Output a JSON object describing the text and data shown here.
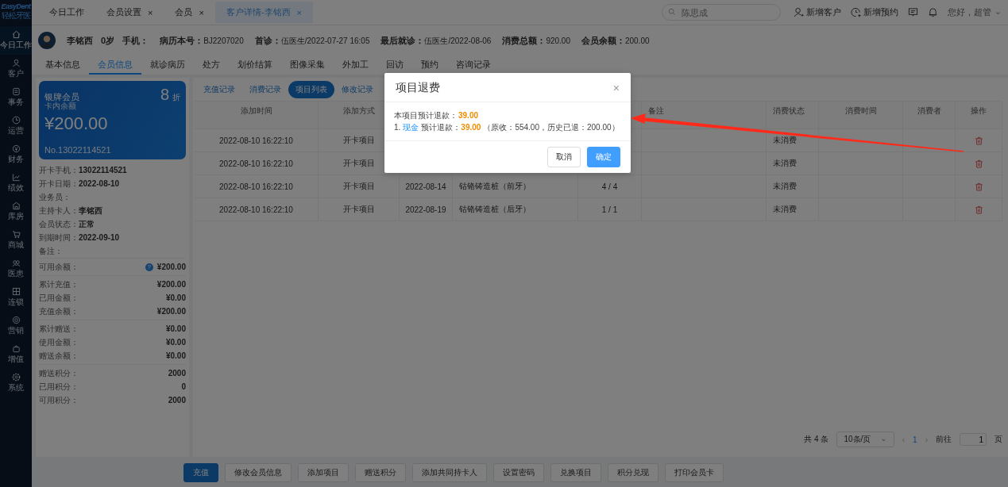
{
  "logo": {
    "brand": "EasyDent",
    "subtitle": "轻松牙医"
  },
  "nav": [
    {
      "label": "今日工作",
      "selected": true
    },
    {
      "label": "客户",
      "selected": false
    },
    {
      "label": "事务",
      "selected": false
    },
    {
      "label": "运营",
      "selected": false
    },
    {
      "label": "财务",
      "selected": false
    },
    {
      "label": "绩效",
      "selected": false
    },
    {
      "label": "库房",
      "selected": false
    },
    {
      "label": "商城",
      "selected": false
    },
    {
      "label": "医患",
      "selected": false
    },
    {
      "label": "连锁",
      "selected": false
    },
    {
      "label": "营销",
      "selected": false
    },
    {
      "label": "增值",
      "selected": false
    },
    {
      "label": "系统",
      "selected": false
    }
  ],
  "tabs": [
    {
      "label": "今日工作",
      "selected": false
    },
    {
      "label": "会员设置",
      "close": "×",
      "selected": false
    },
    {
      "label": "会员",
      "close": "×",
      "selected": false
    },
    {
      "label": "客户详情-李铭西",
      "close": "×",
      "selected": true
    }
  ],
  "search": {
    "placeholder": "陈思成"
  },
  "top_actions": [
    {
      "label": "新增客户"
    },
    {
      "label": "新增预约"
    }
  ],
  "user_menu": {
    "label": "您好，超管",
    "caret": "⌄"
  },
  "patient": {
    "name": "李铭西",
    "age": "0岁",
    "fields": [
      {
        "label": "手机："
      },
      {
        "label": "病历本号：",
        "value": "BJ2207020"
      },
      {
        "label": "首诊：",
        "value": "伍医生/2022-07-27 16:05"
      },
      {
        "label": "最后就诊：",
        "value": "伍医生/2022-08-06"
      },
      {
        "label": "消费总额：",
        "value": "920.00"
      },
      {
        "label": "会员余额：",
        "value": "200.00"
      }
    ]
  },
  "sub_tabs": [
    {
      "label": "基本信息",
      "selected": false
    },
    {
      "label": "会员信息",
      "selected": true
    },
    {
      "label": "就诊病历",
      "selected": false
    },
    {
      "label": "处方",
      "selected": false
    },
    {
      "label": "划价结算",
      "selected": false
    },
    {
      "label": "图像采集",
      "selected": false
    },
    {
      "label": "外加工",
      "selected": false
    },
    {
      "label": "回访",
      "selected": false
    },
    {
      "label": "预约",
      "selected": false
    },
    {
      "label": "咨询记录",
      "selected": false
    }
  ],
  "card": {
    "level": "银牌会员",
    "discount": "8",
    "discount_unit": "折",
    "balance_label": "卡内余额",
    "balance": "¥200.00",
    "number": "No.13022114521"
  },
  "member_info": [
    {
      "label": "开卡手机：",
      "value": "13022114521"
    },
    {
      "label": "开卡日期：",
      "value": "2022-08-10"
    },
    {
      "label": "业务员："
    },
    {
      "label": "主持卡人：",
      "value": "李铭西"
    },
    {
      "label": "会员状态：",
      "value": "正常"
    },
    {
      "label": "到期时间：",
      "value": "2022-09-10"
    },
    {
      "label": "备注："
    }
  ],
  "balance_groups": [
    [
      {
        "label": "可用余额：",
        "value": "¥200.00",
        "help": "?"
      }
    ],
    [
      {
        "label": "累计充值：",
        "value": "¥200.00"
      },
      {
        "label": "已用金额：",
        "value": "¥0.00"
      },
      {
        "label": "充值余额：",
        "value": "¥200.00"
      }
    ],
    [
      {
        "label": "累计赠送：",
        "value": "¥0.00"
      },
      {
        "label": "使用金额：",
        "value": "¥0.00"
      },
      {
        "label": "赠送余额：",
        "value": "¥0.00"
      }
    ],
    [
      {
        "label": "赠送积分：",
        "value": "2000"
      },
      {
        "label": "已用积分：",
        "value": "0"
      },
      {
        "label": "可用积分：",
        "value": "2000"
      }
    ]
  ],
  "record_tabs": [
    {
      "label": "充值记录",
      "selected": false
    },
    {
      "label": "消费记录",
      "selected": false
    },
    {
      "label": "项目列表",
      "selected": true
    },
    {
      "label": "修改记录",
      "selected": false
    }
  ],
  "table": {
    "columns": {
      "added_time": "添加时间",
      "add_method": "添加方式",
      "note": "备注",
      "status": "消费状态",
      "consume_time": "消费时间",
      "consumer": "消费者",
      "action": "操作"
    },
    "rows": [
      {
        "added_time": "2022-08-10 16:22:10",
        "add_method": "开卡项目",
        "status": "未消费"
      },
      {
        "added_time": "2022-08-10 16:22:10",
        "add_method": "开卡项目",
        "status": "未消费"
      },
      {
        "added_time": "2022-08-10 16:22:10",
        "add_method": "开卡项目",
        "column_3": "2022-08-14",
        "column_4": "钴铬铸造桩（前牙）",
        "column_5": "4 / 4",
        "status": "未消费"
      },
      {
        "added_time": "2022-08-10 16:22:10",
        "add_method": "开卡项目",
        "column_3": "2022-08-19",
        "column_4": "钴铬铸造桩（后牙）",
        "column_5": "1 / 1",
        "status": "未消费"
      }
    ]
  },
  "pagination": {
    "total": "共 4 条",
    "page_size": "10条/页",
    "page_size_caret": "⌄",
    "prev": "‹",
    "current": "1",
    "next": "›",
    "goto_label": "前往",
    "goto_value": "1",
    "goto_unit": "页"
  },
  "actions": [
    {
      "label": "充值",
      "primary": true
    },
    {
      "label": "修改会员信息",
      "primary": false
    },
    {
      "label": "添加项目",
      "primary": false
    },
    {
      "label": "赠送积分",
      "primary": false
    },
    {
      "label": "添加共同持卡人",
      "primary": false
    },
    {
      "label": "设置密码",
      "primary": false
    },
    {
      "label": "兑换项目",
      "primary": false
    },
    {
      "label": "积分兑现",
      "primary": false
    },
    {
      "label": "打印会员卡",
      "primary": false
    }
  ],
  "dialog": {
    "title": "项目退费",
    "close": "×",
    "total_label": "本项目预计退款：",
    "total_value": "39.00",
    "method_index": "1.",
    "method": "现金",
    "method_label": "预计退款：",
    "method_value": "39.00",
    "method_detail": "（原收：554.00，历史已退：200.00）",
    "buttons": [
      {
        "label": "取消",
        "primary": false
      },
      {
        "label": "确定",
        "primary": true
      }
    ]
  }
}
